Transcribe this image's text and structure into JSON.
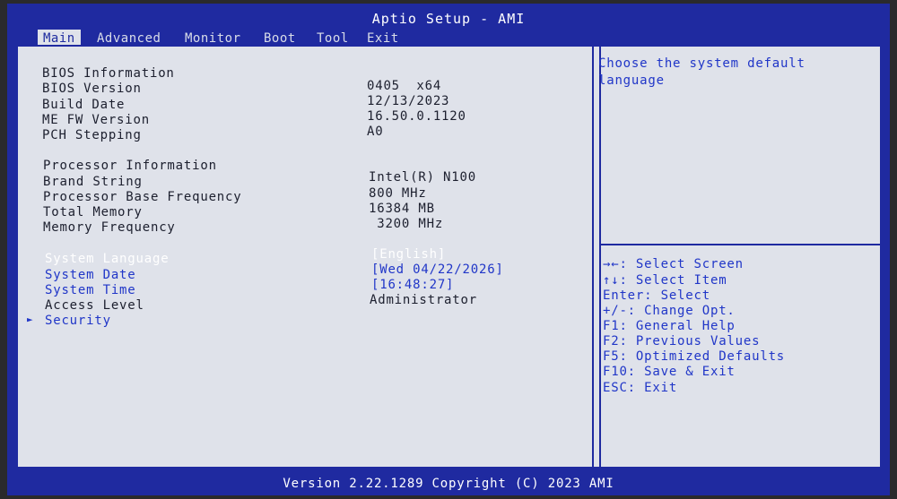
{
  "title": "Aptio Setup - AMI",
  "tabs": [
    "Main",
    "Advanced",
    "Monitor",
    "Boot",
    "Tool",
    "Exit"
  ],
  "active_tab": "Main",
  "bios_section": {
    "heading": "BIOS Information",
    "rows": [
      {
        "label": "BIOS Version",
        "value": "0405  x64"
      },
      {
        "label": "Build Date",
        "value": "12/13/2023"
      },
      {
        "label": "ME FW Version",
        "value": "16.50.0.1120"
      },
      {
        "label": "PCH Stepping",
        "value": "A0"
      }
    ]
  },
  "processor_section": {
    "heading": "Processor Information",
    "rows": [
      {
        "label": "Brand String",
        "value": "Intel(R) N100"
      },
      {
        "label": "Processor Base Frequency",
        "value": "800 MHz"
      },
      {
        "label": "Total Memory",
        "value": "16384 MB"
      },
      {
        "label": "Memory Frequency",
        "value": " 3200 MHz"
      }
    ]
  },
  "settings": {
    "system_language": {
      "label": "System Language",
      "value": "[English]"
    },
    "system_date": {
      "label": "System Date",
      "value": "[Wed 04/22/2026]"
    },
    "system_time": {
      "label": "System Time",
      "value": "[16:48:27]"
    },
    "access_level": {
      "label": "Access Level",
      "value": "Administrator"
    },
    "security": {
      "label": "Security",
      "arrow": "►"
    }
  },
  "help": {
    "description": "Choose the system default language"
  },
  "keys": [
    "→←: Select Screen",
    "↑↓: Select Item",
    "Enter: Select",
    "+/-: Change Opt.",
    "F1: General Help",
    "F2: Previous Values",
    "F5: Optimized Defaults",
    "F10: Save & Exit",
    "ESC: Exit"
  ],
  "footer": "Version 2.22.1289 Copyright (C) 2023 AMI",
  "colors": {
    "frame": "#1f2aa0",
    "panel": "#dfe2ea",
    "highlight": "#2036c8",
    "text": "#1c1f2e"
  }
}
